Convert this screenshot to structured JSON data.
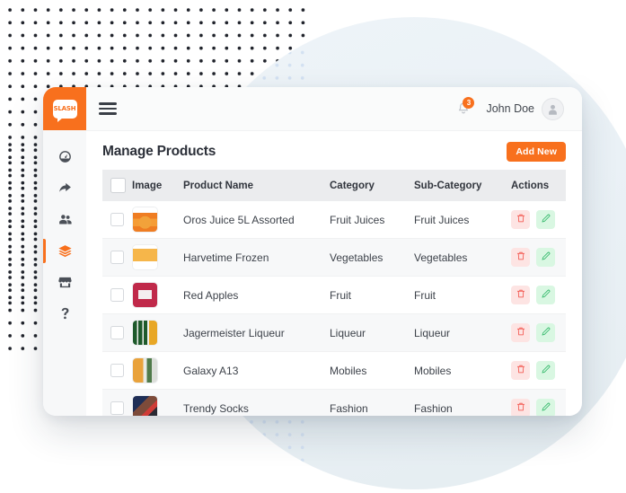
{
  "brand": {
    "logo_text": "SLASH",
    "logo_icon": "speech-bubble-icon"
  },
  "sidebar": {
    "items": [
      {
        "icon": "dashboard-gauge-icon",
        "active": false
      },
      {
        "icon": "share-arrow-icon",
        "active": false
      },
      {
        "icon": "users-icon",
        "active": false
      },
      {
        "icon": "layers-icon",
        "active": true
      },
      {
        "icon": "store-icon",
        "active": false
      },
      {
        "icon": "help-question-icon",
        "active": false
      }
    ]
  },
  "topbar": {
    "menu_icon": "hamburger-icon",
    "bell_icon": "bell-icon",
    "notification_count": "3",
    "user_name": "John Doe",
    "avatar_icon": "user-avatar-icon"
  },
  "page": {
    "title": "Manage Products",
    "add_button": "Add New"
  },
  "table": {
    "columns": [
      "",
      "Image",
      "Product Name",
      "Category",
      "Sub-Category",
      "Actions"
    ],
    "rows": [
      {
        "image": "th-oros",
        "name": "Oros Juice 5L Assorted",
        "category": "Fruit Juices",
        "sub_category": "Fruit Juices"
      },
      {
        "image": "th-harvest",
        "name": "Harvetime Frozen",
        "category": "Vegetables",
        "sub_category": "Vegetables"
      },
      {
        "image": "th-apple",
        "name": "Red Apples",
        "category": "Fruit",
        "sub_category": "Fruit"
      },
      {
        "image": "th-jager",
        "name": "Jagermeister Liqueur",
        "category": "Liqueur",
        "sub_category": "Liqueur"
      },
      {
        "image": "th-galaxy",
        "name": "Galaxy A13",
        "category": "Mobiles",
        "sub_category": "Mobiles"
      },
      {
        "image": "th-socks",
        "name": "Trendy Socks",
        "category": "Fashion",
        "sub_category": "Fashion"
      }
    ],
    "actions": {
      "delete_icon": "trash-icon",
      "edit_icon": "pencil-icon"
    }
  },
  "colors": {
    "brand_orange": "#f8701d",
    "delete_red": "#f1443c",
    "edit_green": "#22b35e",
    "header_gray": "#ebecee",
    "dot_navy": "#20232b",
    "circle_blue": "#eaf1f6"
  }
}
